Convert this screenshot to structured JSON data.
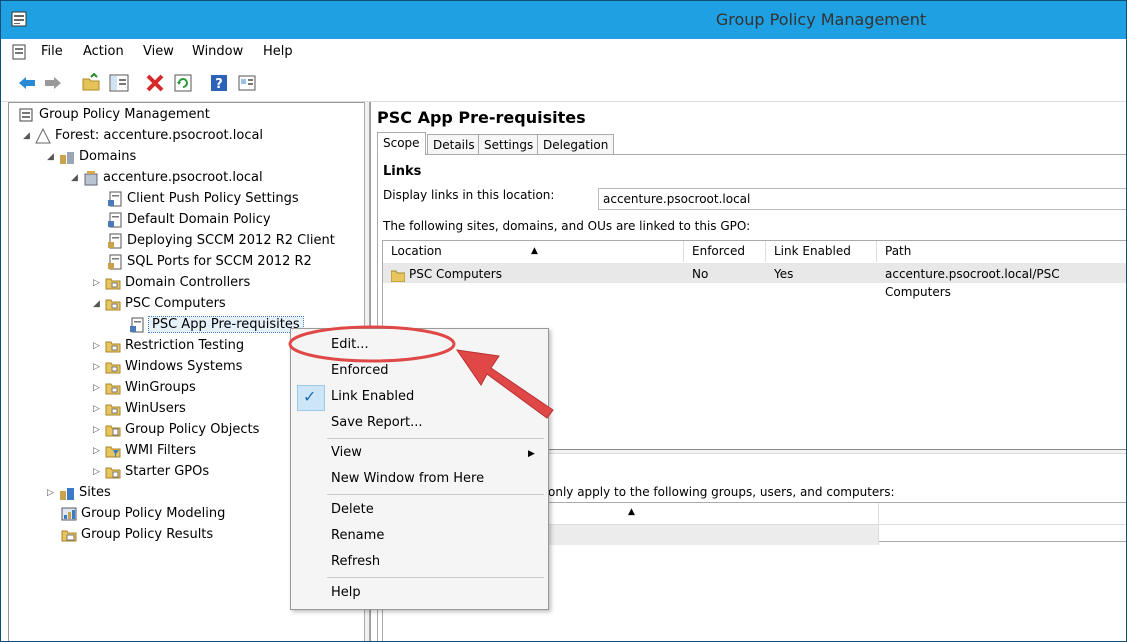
{
  "window": {
    "title": "Group Policy Management"
  },
  "menu": [
    "File",
    "Action",
    "View",
    "Window",
    "Help"
  ],
  "tree": {
    "root": "Group Policy Management",
    "forest": "Forest: accenture.psocroot.local",
    "domains": "Domains",
    "domain": "accenture.psocroot.local",
    "gpo_links": [
      "Client Push Policy Settings",
      "Default Domain Policy",
      "Deploying SCCM 2012 R2 Client",
      "SQL Ports for SCCM 2012 R2"
    ],
    "domain_controllers": "Domain Controllers",
    "psc_computers": "PSC Computers",
    "psc_app": "PSC App Pre-requisites",
    "ous": [
      "Restriction Testing",
      "Windows Systems",
      "WinGroups",
      "WinUsers"
    ],
    "gpo_objects": "Group Policy Objects",
    "wmi_filters": "WMI Filters",
    "starter_gpos": "Starter GPOs",
    "sites": "Sites",
    "modeling": "Group Policy Modeling",
    "results": "Group Policy Results"
  },
  "details": {
    "title": "PSC App Pre-requisites",
    "tabs": [
      "Scope",
      "Details",
      "Settings",
      "Delegation"
    ],
    "links_heading": "Links",
    "display_links_label": "Display links in this location:",
    "location_value": "accenture.psocroot.local",
    "linked_text": "The following sites, domains, and OUs are linked to this GPO:",
    "table": {
      "headers": [
        "Location",
        "Enforced",
        "Link Enabled",
        "Path"
      ],
      "rows": [
        {
          "location": "PSC Computers",
          "enforced": "No",
          "link_enabled": "Yes",
          "path": "accenture.psocroot.local/PSC Computers"
        }
      ]
    },
    "filter_text": "only apply to the following groups, users, and computers:"
  },
  "context_menu": {
    "items": [
      "Edit...",
      "Enforced",
      "Link Enabled",
      "Save Report...",
      "View",
      "New Window from Here",
      "Delete",
      "Rename",
      "Refresh",
      "Help"
    ]
  },
  "colors": {
    "titlebar": "#1ea0e2",
    "annotation": "#e04848",
    "selection": "#cde6f7"
  }
}
